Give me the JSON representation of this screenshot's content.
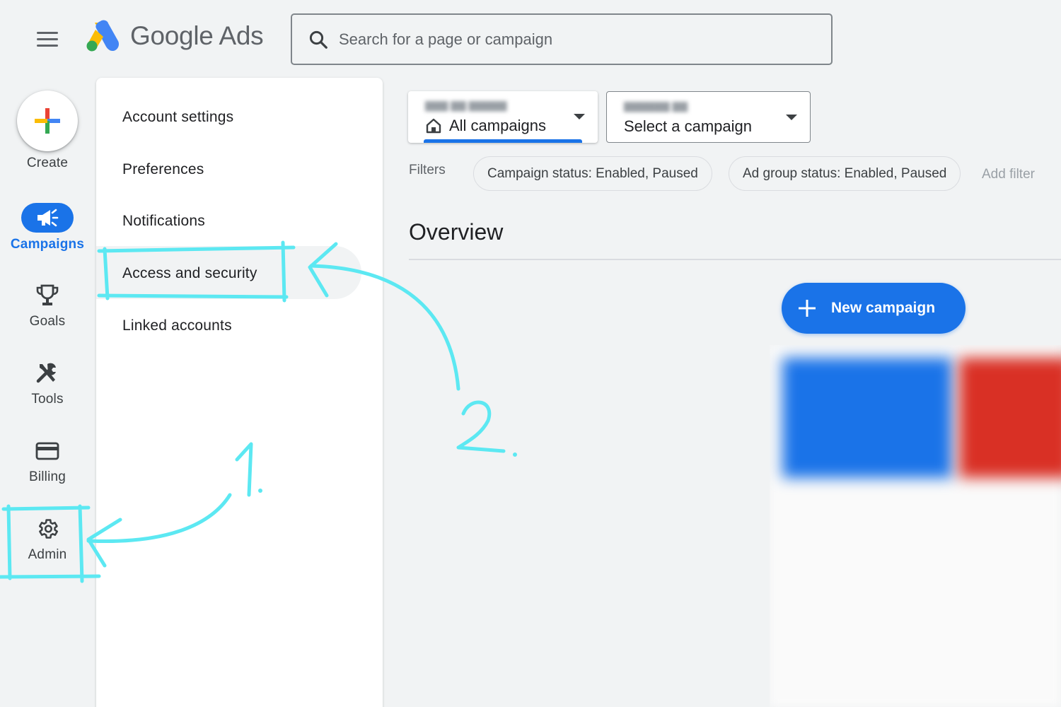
{
  "header": {
    "app_name": "Google Ads",
    "search_placeholder": "Search for a page or campaign"
  },
  "rail": {
    "create_label": "Create",
    "items": [
      {
        "label": "Campaigns",
        "icon": "megaphone-icon",
        "active": true
      },
      {
        "label": "Goals",
        "icon": "trophy-icon"
      },
      {
        "label": "Tools",
        "icon": "tools-icon"
      },
      {
        "label": "Billing",
        "icon": "credit-card-icon"
      },
      {
        "label": "Admin",
        "icon": "gear-icon"
      }
    ]
  },
  "admin_menu": {
    "items": [
      {
        "label": "Account settings"
      },
      {
        "label": "Preferences"
      },
      {
        "label": "Notifications"
      },
      {
        "label": "Access and security",
        "highlighted": true
      },
      {
        "label": "Linked accounts"
      }
    ]
  },
  "main": {
    "view_dropdown": {
      "value": "All campaigns"
    },
    "campaign_dropdown": {
      "value": "Select a campaign"
    },
    "filters_label": "Filters",
    "chips": [
      "Campaign status: Enabled, Paused",
      "Ad group status: Enabled, Paused"
    ],
    "add_filter": "Add filter",
    "page_title": "Overview",
    "new_campaign_label": "New campaign"
  },
  "annotations": {
    "step1": "1.",
    "step2": "2.",
    "color": "#5ce8f2"
  },
  "colors": {
    "accent": "#1a73e8",
    "background": "#f1f3f4"
  }
}
